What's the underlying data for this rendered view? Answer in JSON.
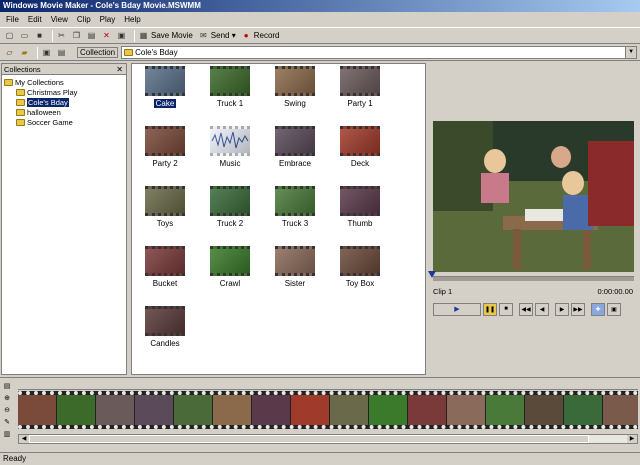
{
  "window": {
    "title": "Windows Movie Maker - Cole's Bday Movie.MSWMM"
  },
  "menu": [
    "File",
    "Edit",
    "View",
    "Clip",
    "Play",
    "Help"
  ],
  "toolbar": {
    "save_movie": "Save Movie",
    "send": "Send ▾",
    "record": "Record"
  },
  "collection_bar": {
    "label": "Collection",
    "value": "Cole's Bday"
  },
  "collections": {
    "header": "Collections",
    "root": "My Collections",
    "items": [
      "Christmas Play",
      "Cole's Bday",
      "halloween",
      "Soccer Game"
    ],
    "selected": "Cole's Bday"
  },
  "clips": [
    {
      "label": "Cake",
      "selected": true
    },
    {
      "label": "Truck 1"
    },
    {
      "label": "Swing"
    },
    {
      "label": "Party 1"
    },
    {
      "label": "Party 2"
    },
    {
      "label": "Music"
    },
    {
      "label": "Embrace"
    },
    {
      "label": "Deck"
    },
    {
      "label": "Toys"
    },
    {
      "label": "Truck 2"
    },
    {
      "label": "Truck 3"
    },
    {
      "label": "Thumb"
    },
    {
      "label": "Bucket"
    },
    {
      "label": "Crawl"
    },
    {
      "label": "Sister"
    },
    {
      "label": "Toy Box"
    },
    {
      "label": "Candles"
    }
  ],
  "monitor": {
    "clip_name": "Clip 1",
    "time": "0:00:00.00"
  },
  "status": "Ready",
  "colors": {
    "title_start": "#0a246a",
    "title_end": "#a6caf0",
    "selection": "#0a246a"
  }
}
